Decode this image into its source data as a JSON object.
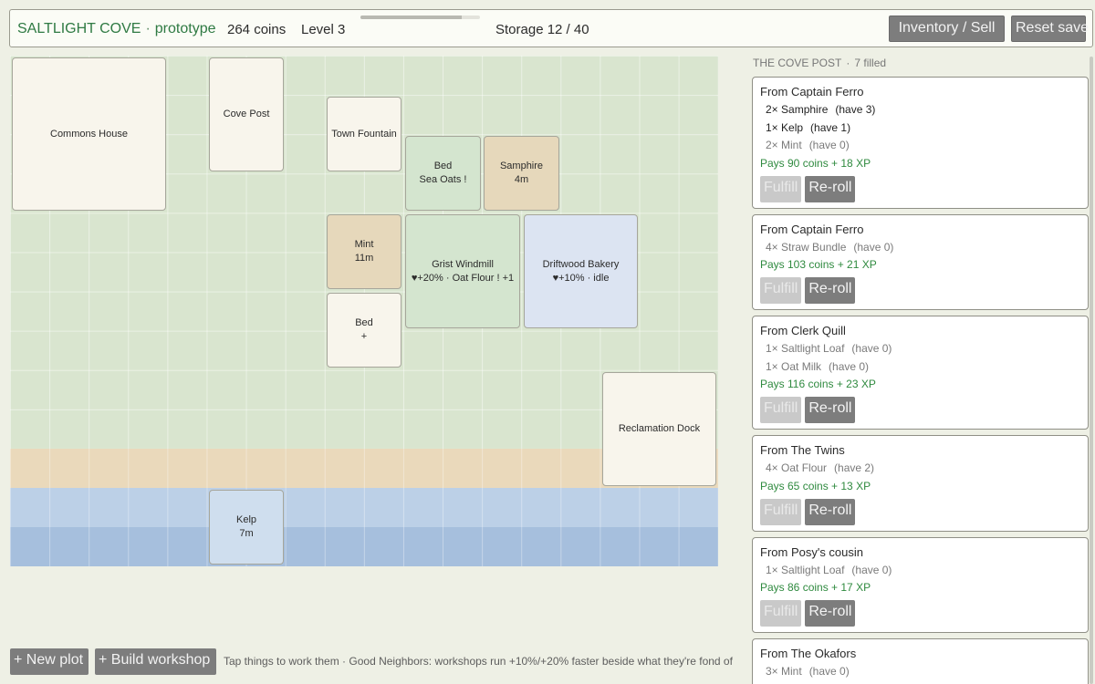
{
  "header": {
    "game_title": "SALTLIGHT COVE",
    "separator": "·",
    "mode": "prototype",
    "coins": "264 coins",
    "level": "Level 3",
    "xp_progress": 0.85,
    "storage": "Storage 12 / 40",
    "inventory_button": "Inventory / Sell",
    "reset_button": "Reset save"
  },
  "board": {
    "commons_house": {
      "label": "Commons House"
    },
    "cove_post": {
      "label": "Cove Post"
    },
    "town_fountain": {
      "label": "Town Fountain"
    },
    "bed_sea_oats": {
      "label": "Bed",
      "status": "Sea Oats !"
    },
    "samphire": {
      "label": "Samphire",
      "status": "4m"
    },
    "mint": {
      "label": "Mint",
      "status": "11m"
    },
    "grist_windmill": {
      "label": "Grist Windmill",
      "status": "♥+20% · Oat Flour ! +1"
    },
    "driftwood_bakery": {
      "label": "Driftwood Bakery",
      "status": "♥+10% · idle"
    },
    "bed_empty": {
      "label": "Bed",
      "status": "+"
    },
    "reclamation_dock": {
      "label": "Reclamation Dock"
    },
    "kelp": {
      "label": "Kelp",
      "status": "7m"
    }
  },
  "bottom": {
    "new_plot": "+ New plot",
    "build_workshop": "+ Build workshop",
    "hint": "Tap things to work them · Good Neighbors: workshops run +10%/+20% faster beside what they're fond of"
  },
  "post": {
    "title": "THE COVE POST",
    "separator": "·",
    "filled": "7 filled",
    "fulfill_label": "Fulfill",
    "reroll_label": "Re-roll",
    "orders": [
      {
        "from": "From Captain Ferro",
        "items": [
          {
            "text": "2× Samphire",
            "have": "(have 3)"
          },
          {
            "text": "1× Kelp",
            "have": "(have 1)"
          },
          {
            "text": "2× Mint",
            "have": "(have 0)"
          }
        ],
        "pays": "Pays 90 coins + 18 XP"
      },
      {
        "from": "From Captain Ferro",
        "items": [
          {
            "text": "4× Straw Bundle",
            "have": "(have 0)"
          }
        ],
        "pays": "Pays 103 coins + 21 XP"
      },
      {
        "from": "From Clerk Quill",
        "items": [
          {
            "text": "1× Saltlight Loaf",
            "have": "(have 0)"
          },
          {
            "text": "1× Oat Milk",
            "have": "(have 0)"
          }
        ],
        "pays": "Pays 116 coins + 23 XP"
      },
      {
        "from": "From The Twins",
        "items": [
          {
            "text": "4× Oat Flour",
            "have": "(have 2)"
          }
        ],
        "pays": "Pays 65 coins + 13 XP"
      },
      {
        "from": "From Posy's cousin",
        "items": [
          {
            "text": "1× Saltlight Loaf",
            "have": "(have 0)"
          }
        ],
        "pays": "Pays 86 coins + 17 XP"
      },
      {
        "from": "From The Okafors",
        "items": [
          {
            "text": "3× Mint",
            "have": "(have 0)"
          }
        ],
        "pays": ""
      }
    ]
  }
}
